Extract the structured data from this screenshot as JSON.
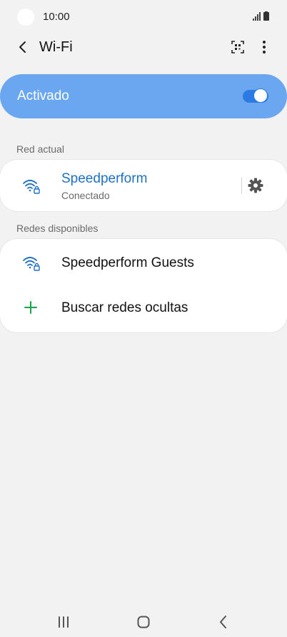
{
  "status_bar": {
    "time": "10:00"
  },
  "app_bar": {
    "title": "Wi-Fi"
  },
  "master_toggle": {
    "label": "Activado",
    "on": true
  },
  "sections": {
    "current": "Red actual",
    "available": "Redes disponibles"
  },
  "current_network": {
    "name": "Speedperform",
    "status": "Conectado"
  },
  "available_networks": [
    {
      "name": "Speedperform Guests"
    }
  ],
  "add_hidden": {
    "label": "Buscar redes ocultas"
  },
  "colors": {
    "accent": "#1f6fc5",
    "toggle_bg": "#6aa7f0",
    "switch_on": "#2a7be3",
    "plus": "#16a34a",
    "background": "#f2f2f2"
  }
}
